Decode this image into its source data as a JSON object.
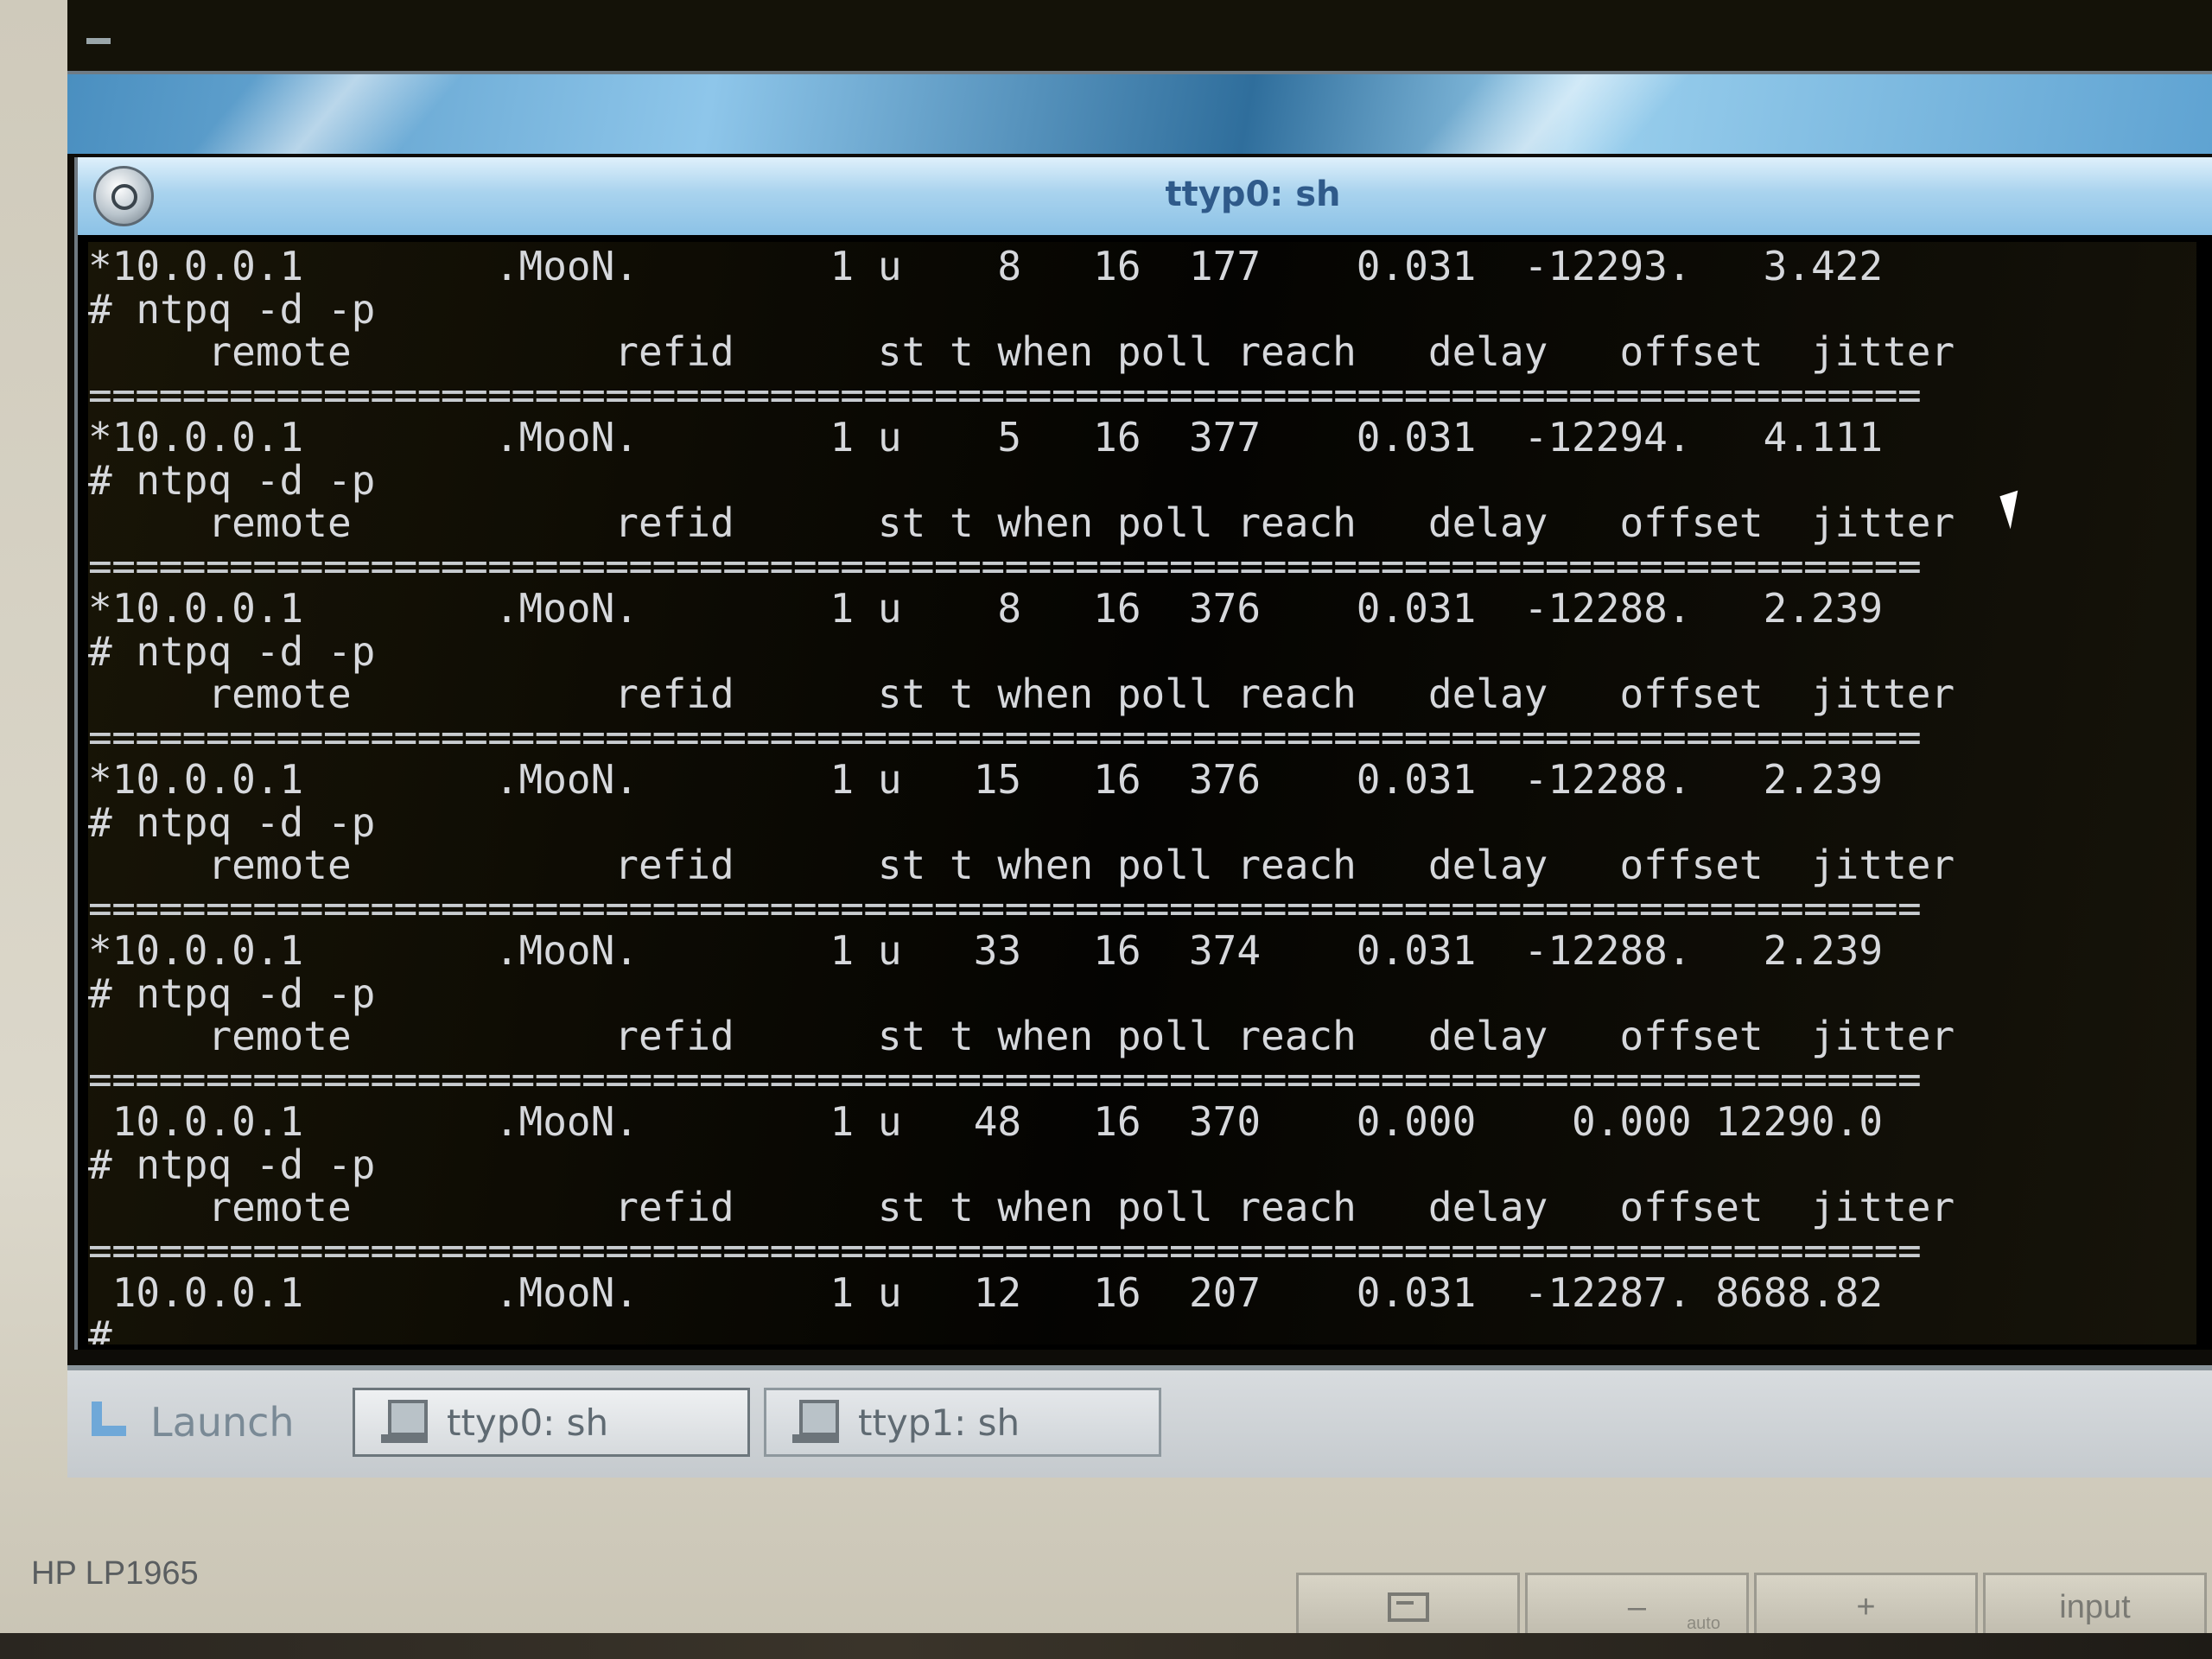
{
  "prev_terminal": {
    "cursor": "_"
  },
  "window": {
    "title": "ttyp0: sh"
  },
  "terminal": {
    "lines": [
      "*10.0.0.1        .MooN.        1 u    8   16  177    0.031  -12293.   3.422",
      "# ntpq -d -p",
      "     remote           refid      st t when poll reach   delay   offset  jitter",
      "==============================================================================",
      "*10.0.0.1        .MooN.        1 u    5   16  377    0.031  -12294.   4.111",
      "# ntpq -d -p",
      "     remote           refid      st t when poll reach   delay   offset  jitter",
      "==============================================================================",
      "*10.0.0.1        .MooN.        1 u    8   16  376    0.031  -12288.   2.239",
      "# ntpq -d -p",
      "     remote           refid      st t when poll reach   delay   offset  jitter",
      "==============================================================================",
      "*10.0.0.1        .MooN.        1 u   15   16  376    0.031  -12288.   2.239",
      "# ntpq -d -p",
      "     remote           refid      st t when poll reach   delay   offset  jitter",
      "==============================================================================",
      "*10.0.0.1        .MooN.        1 u   33   16  374    0.031  -12288.   2.239",
      "# ntpq -d -p",
      "     remote           refid      st t when poll reach   delay   offset  jitter",
      "==============================================================================",
      " 10.0.0.1        .MooN.        1 u   48   16  370    0.000    0.000 12290.0",
      "# ntpq -d -p",
      "     remote           refid      st t when poll reach   delay   offset  jitter",
      "==============================================================================",
      " 10.0.0.1        .MooN.        1 u   12   16  207    0.031  -12287. 8688.82",
      "# _"
    ]
  },
  "taskbar": {
    "launch_label": "Launch",
    "tasks": [
      {
        "label": "ttyp0: sh",
        "icon": "terminal-icon",
        "active": true
      },
      {
        "label": "ttyp1: sh",
        "icon": "terminal-icon",
        "active": false
      }
    ]
  },
  "monitor": {
    "model": "HP LP1965",
    "controls": [
      {
        "label": "",
        "icon": "menu-icon"
      },
      {
        "label": "–",
        "sub": "auto"
      },
      {
        "label": "+"
      },
      {
        "label": "input"
      }
    ]
  }
}
